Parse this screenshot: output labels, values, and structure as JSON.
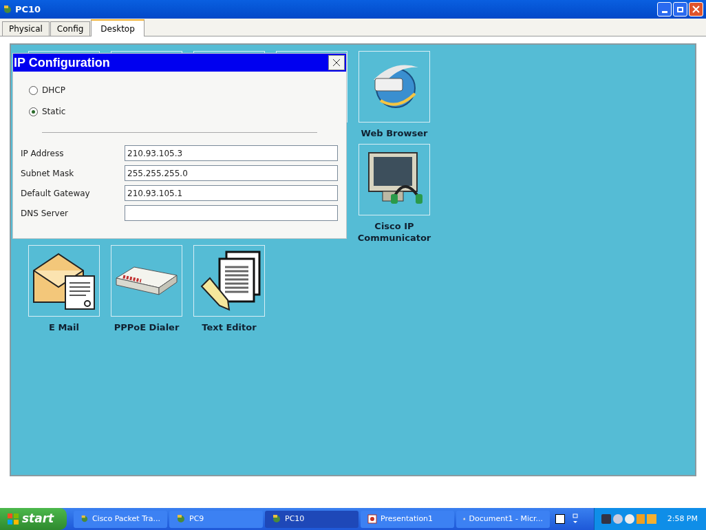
{
  "window": {
    "title": "PC10"
  },
  "tabs": [
    {
      "label": "Physical",
      "selected": false
    },
    {
      "label": "Config",
      "selected": false
    },
    {
      "label": "Desktop",
      "selected": true
    }
  ],
  "apps": [
    {
      "label": "Web Browser",
      "kind": "browser"
    },
    {
      "label": "Cisco IP Communicator",
      "kind": "phone"
    },
    {
      "label": "E Mail",
      "kind": "mail"
    },
    {
      "label": "PPPoE Dialer",
      "kind": "dialer"
    },
    {
      "label": "Text Editor",
      "kind": "editor"
    }
  ],
  "dialog": {
    "title": "IP Configuration",
    "options": [
      {
        "label": "DHCP",
        "selected": false
      },
      {
        "label": "Static",
        "selected": true
      }
    ],
    "fields": [
      {
        "label": "IP Address",
        "value": "210.93.105.3"
      },
      {
        "label": "Subnet Mask",
        "value": "255.255.255.0"
      },
      {
        "label": "Default Gateway",
        "value": "210.93.105.1"
      },
      {
        "label": "DNS Server"
      }
    ]
  },
  "taskbar": {
    "start": "start",
    "tasks": [
      {
        "label": "Cisco Packet Tra...",
        "kind": "packet",
        "selected": false
      },
      {
        "label": "PC9",
        "kind": "packet",
        "selected": false
      },
      {
        "label": "PC10",
        "kind": "packet",
        "selected": true
      },
      {
        "label": "Presentation1",
        "kind": "slides",
        "selected": false
      },
      {
        "label": "Document1 - Micr...",
        "kind": "doc",
        "selected": false
      }
    ],
    "clock": "2:58 PM"
  }
}
